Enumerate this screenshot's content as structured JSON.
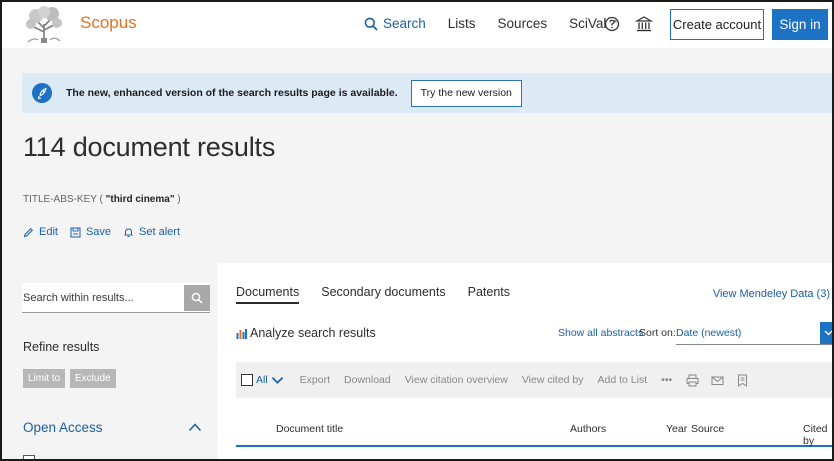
{
  "header": {
    "brand": "Scopus",
    "nav": {
      "search": "Search",
      "lists": "Lists",
      "sources": "Sources",
      "scival": "SciVal",
      "scival_ext": "↗"
    },
    "help_icon": "help-circle-icon",
    "institution_icon": "institution-icon",
    "create_account": "Create account",
    "sign_in": "Sign in"
  },
  "banner": {
    "message": "The new, enhanced version of the search results page is available.",
    "try_button": "Try the new version"
  },
  "results": {
    "title": "114 document results",
    "query_prefix": "TITLE-ABS-KEY (",
    "query_term": " \"third cinema\" ",
    "query_suffix": ")",
    "actions": {
      "edit": "Edit",
      "save": "Save",
      "set_alert": "Set alert"
    }
  },
  "sidebar": {
    "search_placeholder": "Search within results...",
    "refine_title": "Refine results",
    "limit_to": "Limit to",
    "exclude": "Exclude",
    "open_access": "Open Access"
  },
  "main": {
    "tabs": [
      "Documents",
      "Secondary documents",
      "Patents"
    ],
    "active_tab": "Documents",
    "mendeley": "View Mendeley Data (3)",
    "analyze": "Analyze search results",
    "show_abstracts": "Show all abstracts",
    "sort_label": "Sort on:",
    "sort_value": "Date (newest)",
    "toolbar": {
      "all": "All",
      "export": "Export",
      "download": "Download",
      "citation_overview": "View citation overview",
      "cited_by": "View cited by",
      "add_to_list": "Add to List",
      "more": "•••"
    },
    "columns": {
      "title": "Document title",
      "authors": "Authors",
      "year": "Year",
      "source": "Source",
      "cited_by": "Cited by"
    }
  },
  "colors": {
    "brand_orange": "#e9711c",
    "link_blue": "#1a5fa3",
    "primary_blue": "#1d72c4",
    "banner_bg": "#dceaf6",
    "panel_grey": "#f4f4f4"
  }
}
